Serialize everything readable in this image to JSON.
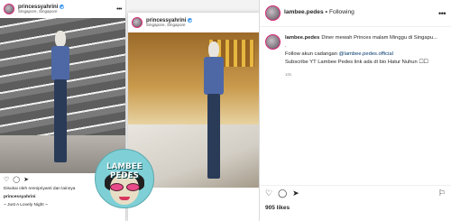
{
  "post_left": {
    "username": "princessyahrini",
    "location": "Singapore, Singapore",
    "liked_by": "Disukai oleh rennipriyanti dan lainnya",
    "caption_user": "princessyahrini",
    "caption_text": "~ Just A Lovely Night ~"
  },
  "post_middle": {
    "username": "princessyahrini",
    "location": "Singapore, Singapore"
  },
  "watermark": {
    "brand": "LAMBEE PEDES"
  },
  "panel": {
    "username": "lambee.pedes",
    "follow_label": "Following",
    "comment_user": "lambee.pedes",
    "comment_line1": "Diner mewah Princes malam Minggu di Singapu...",
    "comment_dot": ".",
    "comment_line2_prefix": "Follow akun cadangan",
    "comment_handle": "@lambee.pedes.official",
    "comment_line3": "Subscribe YT Lambee Pedes link ada di bio Hatur Nuhun ☐☐",
    "comment_time": "10s",
    "likes": "905 likes"
  },
  "icons": {
    "heart": "heart-icon",
    "comment": "comment-icon",
    "share": "share-icon",
    "save": "bookmark-icon",
    "more": "more-icon",
    "verified": "verified-badge-icon"
  }
}
